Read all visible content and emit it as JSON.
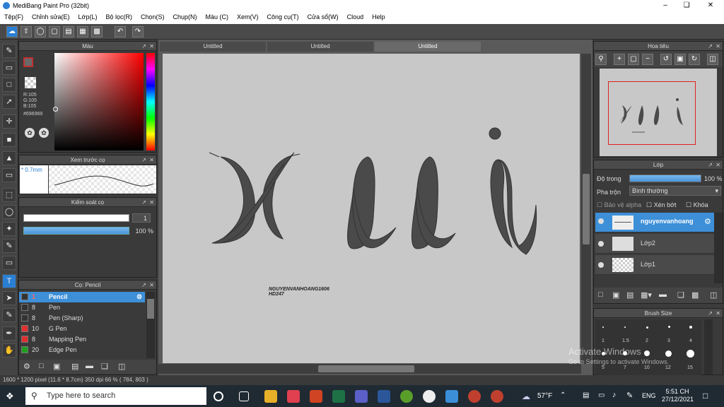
{
  "app": {
    "title": "MediBang Paint Pro (32bit)"
  },
  "menu": [
    "Tệp(F)",
    "Chỉnh sửa(E)",
    "Lớp(L)",
    "Bộ lọc(R)",
    "Chọn(S)",
    "Chụp(N)",
    "Màu (C)",
    "Xem(V)",
    "Công cụ(T)",
    "Cửa sổ(W)",
    "Cloud",
    "Help"
  ],
  "tabs": [
    "Untitled",
    "Untitled",
    "Untitled"
  ],
  "color_panel": {
    "title": "Màu",
    "r": "R:105",
    "g": "G:105",
    "b": "B:105",
    "hex": "#696969"
  },
  "brush_preview": {
    "title": "Xem trước cọ",
    "size": "* 0.7mm"
  },
  "brush_control": {
    "title": "Kiểm soát cọ",
    "size_value": "1",
    "opacity_value": "100 %"
  },
  "brush_list": {
    "title": "Cọ: Pencil",
    "items": [
      {
        "size": "1",
        "name": "Pencil",
        "color": "#333333",
        "selected": true
      },
      {
        "size": "8",
        "name": "Pen",
        "color": "#333333",
        "selected": false
      },
      {
        "size": "8",
        "name": "Pen (Sharp)",
        "color": "#333333",
        "selected": false
      },
      {
        "size": "10",
        "name": "G Pen",
        "color": "#e03030",
        "selected": false
      },
      {
        "size": "8",
        "name": "Mapping Pen",
        "color": "#e03030",
        "selected": false
      },
      {
        "size": "20",
        "name": "Edge Pen",
        "color": "#20a020",
        "selected": false
      }
    ]
  },
  "canvas": {
    "letters": "xui",
    "signature_line1": "NGUYENVANHOANG1606",
    "signature_line2": "HD247"
  },
  "navigator": {
    "title": "Hoa tiêu"
  },
  "layers": {
    "title": "Lớp",
    "opacity_label": "Độ trong",
    "opacity_value": "100 %",
    "opacity_fraction": 1.0,
    "blend_label": "Pha trộn",
    "blend_value": "Bình thường",
    "protect_alpha": "Bảo vệ alpha",
    "clipping": "Xén bớt",
    "lock": "Khóa",
    "items": [
      {
        "name": "nguyenvanhoang",
        "selected": true
      },
      {
        "name": "Lớp2",
        "selected": false
      },
      {
        "name": "Lớp1",
        "selected": false
      }
    ]
  },
  "brush_size": {
    "title": "Brush Size",
    "row1": [
      "1",
      "1.5",
      "2",
      "3",
      "4"
    ],
    "row2": [
      "5",
      "7",
      "10",
      "12",
      "15"
    ]
  },
  "status": {
    "text": "1600 * 1200 pixel   (11.6 * 8.7cm)   350 dpi   66 %   ( 784, 803 )"
  },
  "watermark": {
    "line1": "Activate Windows",
    "line2": "Go to Settings to activate Windows."
  },
  "taskbar": {
    "search_placeholder": "Type here to search",
    "weather": "57°F",
    "lang": "ENG",
    "time": "5:51 CH",
    "date": "27/12/2021"
  }
}
